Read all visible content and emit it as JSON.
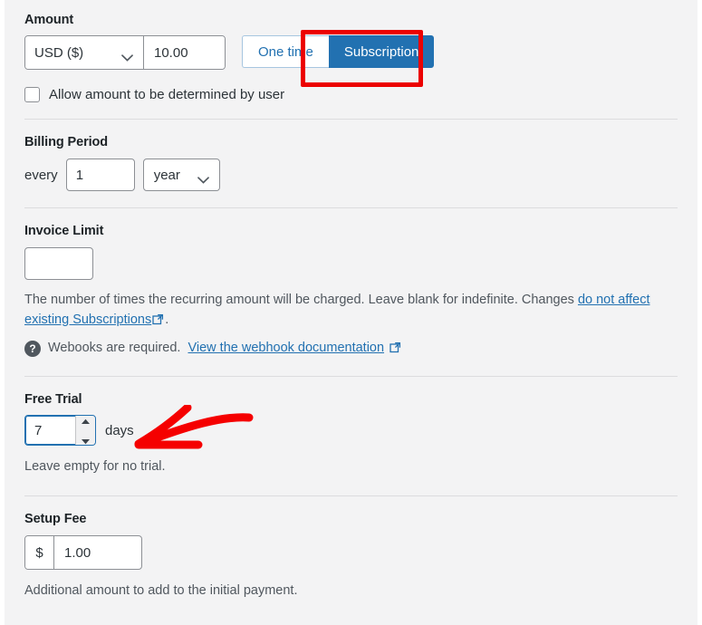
{
  "amount": {
    "label": "Amount",
    "currency_selected": "USD ($)",
    "value": "10.00",
    "one_time_label": "One time",
    "subscription_label": "Subscription",
    "active_toggle": "Subscription",
    "allow_user_amount_label": "Allow amount to be determined by user",
    "allow_user_amount_checked": false
  },
  "billing_period": {
    "label": "Billing Period",
    "every_label": "every",
    "interval_value": "1",
    "period_selected": "year"
  },
  "invoice_limit": {
    "label": "Invoice Limit",
    "value": "",
    "desc_part1": "The number of times the recurring amount will be charged. Leave blank for indefinite. Changes ",
    "desc_link": "do not affect existing Subscriptions",
    "desc_part2": ".",
    "webhook_text": "Webooks are required.",
    "webhook_link": "View the webhook documentation"
  },
  "free_trial": {
    "label": "Free Trial",
    "value": "7",
    "unit_label": "days",
    "desc": "Leave empty for no trial."
  },
  "setup_fee": {
    "label": "Setup Fee",
    "currency_symbol": "$",
    "value": "1.00",
    "desc": "Additional amount to add to the initial payment."
  },
  "icons": {
    "help": "?",
    "chevron_down": "chevron-down-icon",
    "external_link": "external-link-icon",
    "spinner_up": "spinner-up-icon",
    "spinner_down": "spinner-down-icon"
  },
  "annotations": {
    "highlight_target": "Subscription",
    "highlight_color": "#ec0000",
    "arrow_color": "#f50000",
    "arrow_points_to": "free-trial-input"
  },
  "colors": {
    "accent": "#2271b1",
    "panel_bg": "#f3f3f4",
    "divider": "#dcdcde",
    "text": "#2c3338",
    "muted_text": "#50575e",
    "annotation_red": "#ec0000"
  }
}
